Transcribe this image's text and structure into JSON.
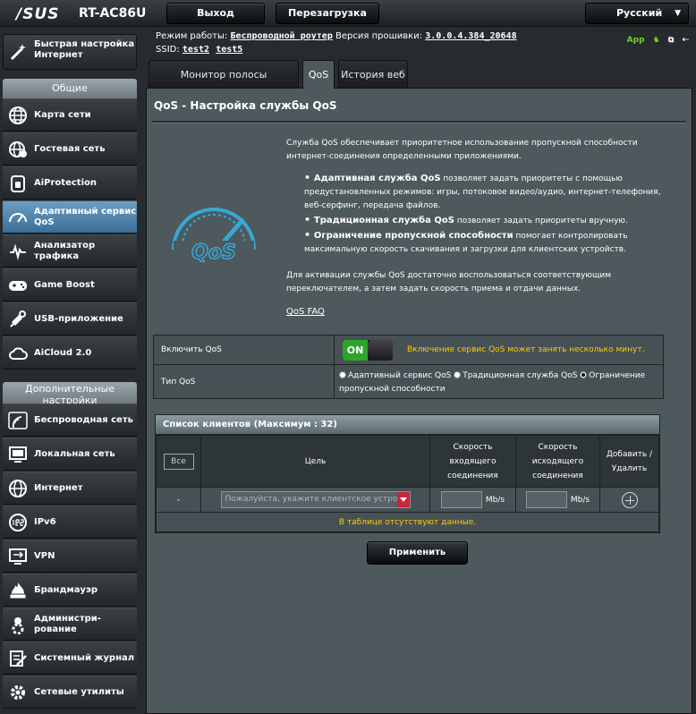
{
  "brand": {
    "logo": "/SUS",
    "model": "RT-AC86U"
  },
  "topbar": {
    "logout_label": "Выход",
    "reboot_label": "Перезагрузка",
    "language": "Русский"
  },
  "info": {
    "mode_label": "Режим работы:",
    "mode_value": "Беспроводной роутер",
    "firmware_label": "Версия прошивки:",
    "firmware_value": "3.0.0.4.384_20648",
    "ssid_label": "SSID:",
    "ssid_1": "test2",
    "ssid_2": "test5",
    "app_label": "App"
  },
  "sidebar": {
    "quick_setup": [
      "Быстрая настройка",
      "Интернет"
    ],
    "general_header": "Общие",
    "general_items": [
      {
        "label": "Карта сети",
        "icon": "globe-icon"
      },
      {
        "label": "Гостевая сеть",
        "icon": "guest-globe-icon"
      },
      {
        "label": "AiProtection",
        "icon": "lock-icon"
      },
      {
        "label": [
          "Адаптивный сервис",
          "QoS"
        ],
        "icon": "speedometer-icon",
        "active": true
      },
      {
        "label": [
          "Анализатор",
          "трафика"
        ],
        "icon": "traffic-icon"
      },
      {
        "label": "Game Boost",
        "icon": "gamepad-icon"
      },
      {
        "label": "USB-приложение",
        "icon": "puzzle-icon"
      },
      {
        "label": "AiCloud 2.0",
        "icon": "cloud-icon"
      }
    ],
    "advanced_header": "Дополнительные настройки",
    "advanced_items": [
      {
        "label": "Беспроводная сеть",
        "icon": "wifi-icon"
      },
      {
        "label": "Локальная сеть",
        "icon": "monitor-icon"
      },
      {
        "label": "Интернет",
        "icon": "globe-icon"
      },
      {
        "label": "IPv6",
        "icon": "ipv6-icon"
      },
      {
        "label": "VPN",
        "icon": "vpn-icon"
      },
      {
        "label": "Брандмауэр",
        "icon": "fire-icon"
      },
      {
        "label": [
          "Администри-",
          "рование"
        ],
        "icon": "admin-icon"
      },
      {
        "label": "Системный журнал",
        "icon": "log-icon"
      },
      {
        "label": "Сетевые утилиты",
        "icon": "tools-icon"
      }
    ]
  },
  "tabs": [
    {
      "label": "Монитор полосы пропускания"
    },
    {
      "label": "QoS",
      "active": true
    },
    {
      "label": "История веб"
    }
  ],
  "main": {
    "title": "QoS - Настройка службы QoS",
    "intro": "Служба QoS обеспечивает приоритетное использование пропускной способности интернет-соединения определенными приложениями.",
    "bullets": [
      {
        "bold": "Адаптивная служба QoS",
        "text": " позволяет задать приоритеты с помощью предустановленных режимов: игры, потоковое видео/аудио, интернет-телефония, веб-серфинг, передача файлов."
      },
      {
        "bold": "Традиционная служба QoS",
        "text": " позволяет задать приоритеты вручную."
      },
      {
        "bold": "Ограничение пропускной способности",
        "text": " помогает контролировать максимальную скорость скачивания и загрузки для клиентских устройств."
      }
    ],
    "activation": "Для активации службы QoS достаточно воспользоваться соответствующим переключателем, а затем задать скорость приема и отдачи данных.",
    "faq": "QoS FAQ",
    "logo_text": "QoS",
    "enable_label": "Включить QoS",
    "toggle_on": "ON",
    "enable_note": "Включение сервис QoS может занять несколько минут.",
    "type_label": "Тип QoS",
    "type_options": [
      {
        "label": "Адаптивный сервис QoS",
        "selected": false
      },
      {
        "label": "Традиционная служба QoS",
        "selected": false
      },
      {
        "label": "Ограничение пропускной способности",
        "selected": true
      }
    ],
    "clients": {
      "header": "Список клиентов (Максимум : 32)",
      "col_all": "Все",
      "col_target": "Цель",
      "col_down": [
        "Скорость",
        "входящего",
        "соединения"
      ],
      "col_up": [
        "Скорость",
        "исходящего",
        "соединения"
      ],
      "col_action": [
        "Добавить /",
        "Удалить"
      ],
      "row_dash": "-",
      "placeholder": "Пожалуйста, укажите клиентское устройство",
      "unit": "Mb/s",
      "no_data": "В таблице отсутствуют данные."
    },
    "apply_label": "Применить"
  }
}
